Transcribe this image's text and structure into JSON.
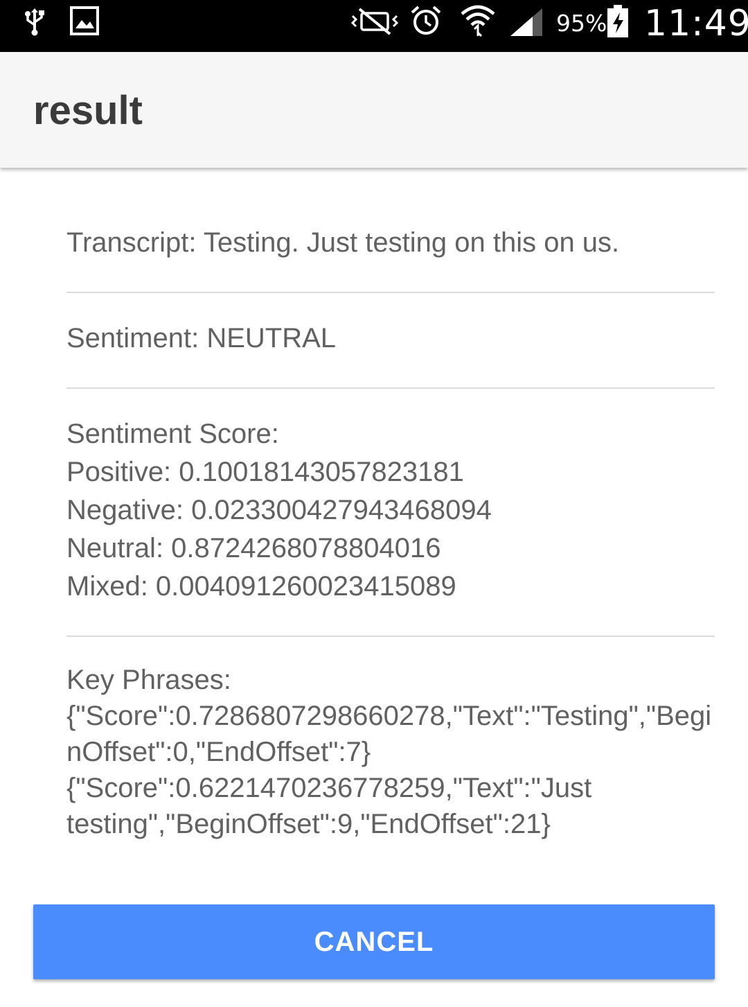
{
  "status_bar": {
    "icons": [
      "usb-icon",
      "image-icon",
      "vibrate-mute-icon",
      "alarm-icon",
      "wifi-icon",
      "signal-icon",
      "battery-charging-icon"
    ],
    "battery_percent": "95%",
    "time": "11:49"
  },
  "app_bar": {
    "title": "result"
  },
  "result": {
    "transcript": "Transcript: Testing. Just testing on this on us.",
    "sentiment": "Sentiment: NEUTRAL",
    "sentiment_score": "Sentiment Score:\nPositive: 0.10018143057823181\nNegative: 0.023300427943468094\nNeutral: 0.8724268078804016\nMixed: 0.004091260023415089",
    "key_phrases": "Key Phrases:\n{\"Score\":0.7286807298660278,\"Text\":\"Testing\",\"BeginOffset\":0,\"EndOffset\":7}\n{\"Score\":0.6221470236778259,\"Text\":\"Just testing\",\"BeginOffset\":9,\"EndOffset\":21}"
  },
  "actions": {
    "cancel_label": "CANCEL",
    "cancel_color": "#4a8cfe"
  }
}
